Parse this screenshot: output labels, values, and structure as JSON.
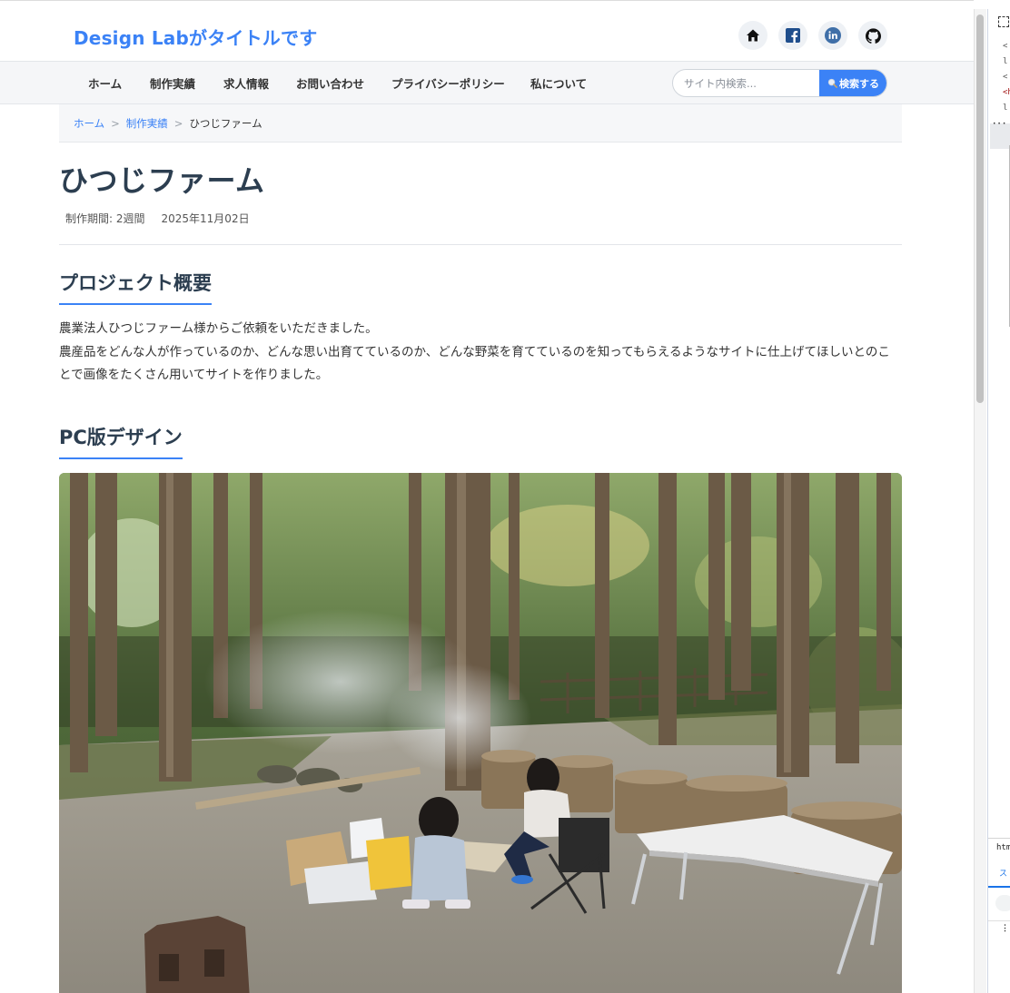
{
  "header": {
    "site_title": "Design Labがタイトルです",
    "social_icons": [
      "home-icon",
      "facebook-icon",
      "linkedin-icon",
      "github-icon"
    ]
  },
  "nav": {
    "items": [
      {
        "label": "ホーム"
      },
      {
        "label": "制作実績"
      },
      {
        "label": "求人情報"
      },
      {
        "label": "お問い合わせ"
      },
      {
        "label": "プライバシーポリシー"
      },
      {
        "label": "私について"
      }
    ],
    "search": {
      "placeholder": "サイト内検索...",
      "value": "",
      "button_label": "検索する"
    }
  },
  "breadcrumb": {
    "items": [
      "ホーム",
      "制作実績"
    ],
    "separator": ">",
    "current": "ひつじファーム"
  },
  "article": {
    "title": "ひつじファーム",
    "period": "制作期間: 2週間",
    "date": "2025年11月02日",
    "overview_heading": "プロジェクト概要",
    "overview_lines": [
      "農業法人ひつじファーム様からご依頼をいただきました。",
      "農産品をどんな人が作っているのか、どんな思い出育てているのか、どんな野菜を育てているのを知ってもらえるようなサイトに仕上げてほしいとのことで画像をたくさん用いてサイトを作りました。"
    ],
    "pc_heading": "PC版デザイン"
  },
  "devtools": {
    "lines": [
      "<",
      "l",
      "<",
      "<h",
      "l"
    ],
    "footer_tab": "htm",
    "styles_tab": "ス"
  },
  "colors": {
    "accent": "#3b82f6",
    "heading": "#2c3e50",
    "nav_bg": "#f5f6f8",
    "breadcrumb_bg": "#f6f7f9"
  }
}
